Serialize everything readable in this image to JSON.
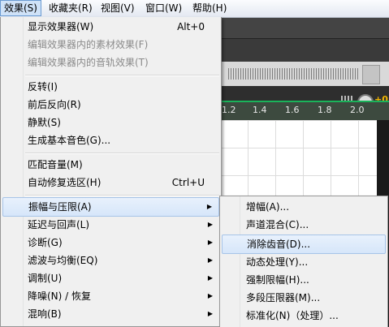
{
  "menubar": {
    "items": [
      "效果(S)",
      "收藏夹(R)",
      "视图(V)",
      "窗口(W)",
      "帮助(H)"
    ]
  },
  "effects_menu": {
    "items": [
      {
        "label": "显示效果器(W)",
        "shortcut": "Alt+0",
        "enabled": true
      },
      {
        "label": "编辑效果器内的素材效果(F)",
        "shortcut": "",
        "enabled": false
      },
      {
        "label": "编辑效果器内的音轨效果(T)",
        "shortcut": "",
        "enabled": false
      },
      {
        "label": "反转(I)",
        "shortcut": "",
        "enabled": true
      },
      {
        "label": "前后反向(R)",
        "shortcut": "",
        "enabled": true
      },
      {
        "label": "静默(S)",
        "shortcut": "",
        "enabled": true
      },
      {
        "label": "生成基本音色(G)...",
        "shortcut": "",
        "enabled": true
      },
      {
        "label": "匹配音量(M)",
        "shortcut": "",
        "enabled": true
      },
      {
        "label": "自动修复选区(H)",
        "shortcut": "Ctrl+U",
        "enabled": true
      },
      {
        "label": "振幅与压限(A)",
        "shortcut": "",
        "enabled": true,
        "submenu": true,
        "highlighted": true
      },
      {
        "label": "延迟与回声(L)",
        "shortcut": "",
        "enabled": true,
        "submenu": true
      },
      {
        "label": "诊断(G)",
        "shortcut": "",
        "enabled": true,
        "submenu": true
      },
      {
        "label": "滤波与均衡(EQ)",
        "shortcut": "",
        "enabled": true,
        "submenu": true
      },
      {
        "label": "调制(U)",
        "shortcut": "",
        "enabled": true,
        "submenu": true
      },
      {
        "label": "降噪(N) / 恢复",
        "shortcut": "",
        "enabled": true,
        "submenu": true
      },
      {
        "label": "混响(B)",
        "shortcut": "",
        "enabled": true,
        "submenu": true
      }
    ]
  },
  "amplitude_submenu": {
    "items": [
      {
        "label": "增幅(A)...",
        "highlighted": false
      },
      {
        "label": "声道混合(C)...",
        "highlighted": false
      },
      {
        "label": "消除齿音(D)...",
        "highlighted": true
      },
      {
        "label": "动态处理(Y)...",
        "highlighted": false
      },
      {
        "label": "强制限幅(H)...",
        "highlighted": false
      },
      {
        "label": "多段压限器(M)...",
        "highlighted": false
      },
      {
        "label": "标准化(N)（处理）...",
        "highlighted": false
      }
    ]
  },
  "timeline": {
    "ruler_labels": [
      "1.2",
      "1.4",
      "1.6",
      "1.8",
      "2.0"
    ],
    "level_readout": "+0"
  },
  "colors": {
    "menu_bg": "#f0f0f0",
    "highlight_bg": "#d6e6fa",
    "ruler_green": "#1ab35a",
    "level_orange": "#f2b500"
  }
}
